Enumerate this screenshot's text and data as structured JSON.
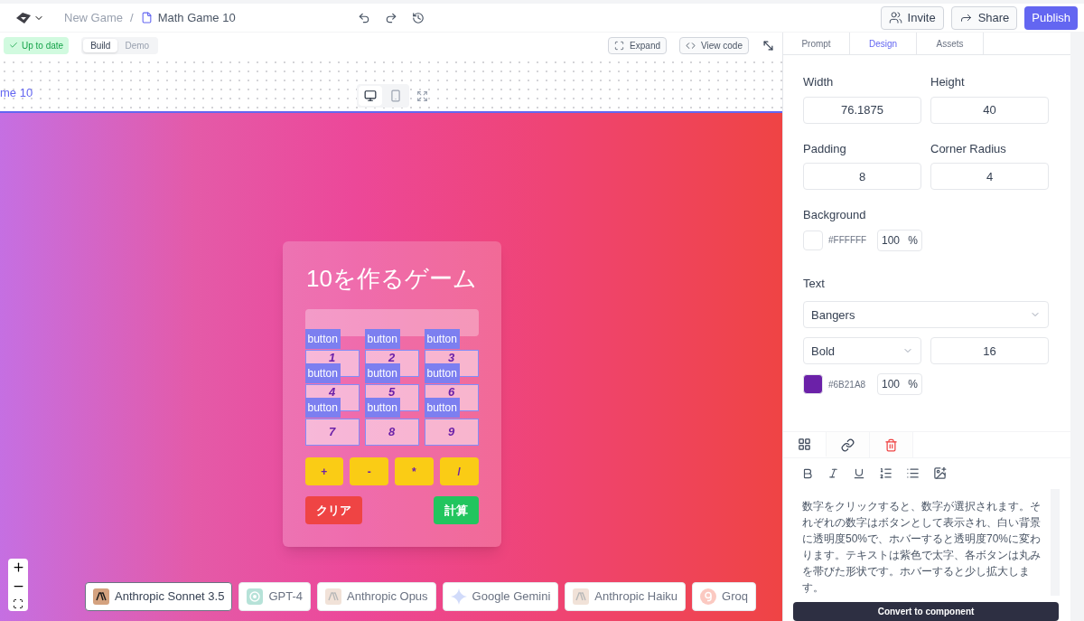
{
  "header": {
    "breadcrumb": [
      "New Game",
      "Math Game 10"
    ],
    "separator": "/",
    "buttons": [
      {
        "label": "Invite",
        "kind": "invite"
      },
      {
        "label": "Share",
        "kind": "share"
      },
      {
        "label": "Publish",
        "kind": "publish"
      }
    ]
  },
  "toolbar": {
    "status": "Up to date",
    "modes": [
      {
        "label": "Build",
        "selected": true
      },
      {
        "label": "Demo",
        "selected": false
      }
    ],
    "expand": "Expand",
    "view_code": "View code"
  },
  "canvas": {
    "frame_title": "me 10",
    "devices": [
      {
        "kind": "desktop",
        "selected": true
      },
      {
        "kind": "mobile",
        "selected": false
      }
    ]
  },
  "game": {
    "title": "10を作るゲーム",
    "cells": [
      {
        "digit": "1",
        "tag": "button"
      },
      {
        "digit": "2",
        "tag": "button"
      },
      {
        "digit": "3",
        "tag": "button"
      },
      {
        "digit": "4",
        "tag": "button"
      },
      {
        "digit": "5",
        "tag": "button"
      },
      {
        "digit": "6",
        "tag": "button"
      },
      {
        "digit": "7",
        "tag": "button"
      },
      {
        "digit": "8",
        "tag": "button"
      },
      {
        "digit": "9",
        "tag": "button"
      }
    ],
    "operators": [
      "+",
      "-",
      "*",
      "/"
    ],
    "clear": "クリア",
    "calculate": "計算"
  },
  "models": [
    {
      "name": "Anthropic Sonnet 3.5",
      "kind": "anthropic",
      "selected": true
    },
    {
      "name": "GPT-4",
      "kind": "openai",
      "selected": false
    },
    {
      "name": "Anthropic Opus",
      "kind": "anthropic",
      "selected": false
    },
    {
      "name": "Google Gemini",
      "kind": "gemini",
      "selected": false
    },
    {
      "name": "Anthropic Haiku",
      "kind": "anthropic",
      "selected": false
    },
    {
      "name": "Groq",
      "kind": "groq",
      "selected": false
    }
  ],
  "panel": {
    "tabs": [
      {
        "label": "Prompt",
        "selected": false
      },
      {
        "label": "Design",
        "selected": true
      },
      {
        "label": "Assets",
        "selected": false
      }
    ],
    "width": {
      "label": "Width",
      "value": "76.1875"
    },
    "height": {
      "label": "Height",
      "value": "40"
    },
    "padding": {
      "label": "Padding",
      "value": "8"
    },
    "radius": {
      "label": "Corner Radius",
      "value": "4"
    },
    "background": {
      "label": "Background",
      "color": "#ffffff",
      "hex": "#FFFFFF",
      "opacity": "100",
      "unit": "%"
    },
    "text": {
      "label": "Text",
      "font": "Bangers",
      "weight": "Bold",
      "size": "16",
      "color": "#6b21a8",
      "hex": "#6B21A8",
      "opacity": "100",
      "unit": "%"
    },
    "section_tabs": [
      {
        "kind": "components",
        "selected": true
      },
      {
        "kind": "link",
        "selected": false
      },
      {
        "kind": "delete",
        "selected": false
      }
    ],
    "description": "数字をクリックすると、数字が選択されます。それぞれの数字はボタンとして表示され、白い背景に透明度50%で、ホバーすると透明度70%に変わります。テキストは紫色で太字、各ボタンは丸みを帯びた形状です。ホバーすると少し拡大します。",
    "convert": "Convert to component"
  }
}
